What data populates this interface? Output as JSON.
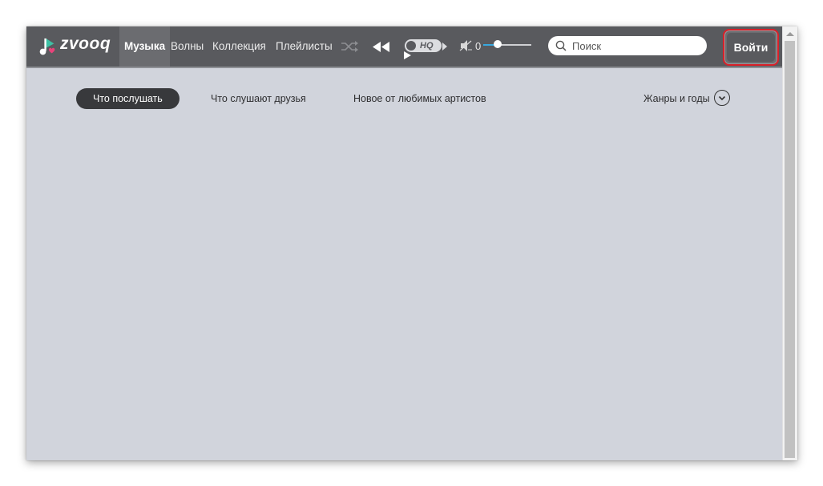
{
  "brand": {
    "name": "zvooq"
  },
  "nav": {
    "items": [
      {
        "label": "Музыка",
        "active": true
      },
      {
        "label": "Волны",
        "active": false
      },
      {
        "label": "Коллекция",
        "active": false
      },
      {
        "label": "Плейлисты",
        "active": false
      }
    ]
  },
  "player": {
    "hq_label": "HQ",
    "volume_value": "0",
    "volume_level": 0.3
  },
  "search": {
    "placeholder": "Поиск"
  },
  "auth": {
    "login_label": "Войти"
  },
  "tabs": {
    "items": [
      {
        "label": "Что послушать",
        "active": true
      },
      {
        "label": "Что слушают друзья",
        "active": false
      },
      {
        "label": "Новое от любимых артистов",
        "active": false
      }
    ],
    "genres_label": "Жанры и годы"
  },
  "colors": {
    "topbar": "#595a5e",
    "content_bg": "#d1d4dc",
    "accent_red": "#d9212a",
    "volume_blue": "#38a8df"
  }
}
